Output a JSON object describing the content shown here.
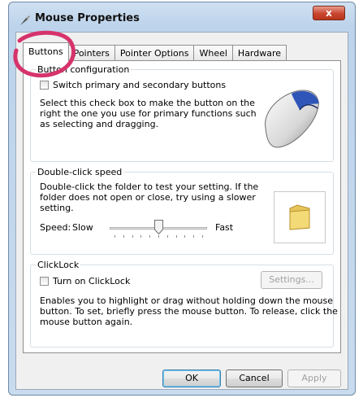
{
  "window": {
    "title": "Mouse Properties",
    "close_label": "x"
  },
  "tabs": [
    {
      "label": "Buttons",
      "active": true
    },
    {
      "label": "Pointers"
    },
    {
      "label": "Pointer Options"
    },
    {
      "label": "Wheel"
    },
    {
      "label": "Hardware"
    }
  ],
  "button_config": {
    "legend": "Button configuration",
    "switch_label": "Switch primary and secondary buttons",
    "switch_checked": false,
    "description": [
      "Select this check box to make the button on the",
      "right the one you use for primary functions such",
      "as selecting and dragging."
    ]
  },
  "double_click": {
    "legend": "Double-click speed",
    "description": [
      "Double-click the folder to test your setting. If the",
      "folder does not open or close, try using a slower",
      "setting."
    ],
    "speed_label": "Speed:",
    "slow_label": "Slow",
    "fast_label": "Fast",
    "speed_value": 0.5
  },
  "clicklock": {
    "legend": "ClickLock",
    "turn_on_label": "Turn on ClickLock",
    "turn_on_checked": false,
    "settings_label": "Settings...",
    "description": [
      "Enables you to highlight or drag without holding down the mouse",
      "button. To set, briefly press the mouse button. To release, click the",
      "mouse button again."
    ]
  },
  "footer": {
    "ok_label": "OK",
    "cancel_label": "Cancel",
    "apply_label": "Apply"
  },
  "colors": {
    "annotation": "#d6336c",
    "accent": "#3c7fb1"
  }
}
